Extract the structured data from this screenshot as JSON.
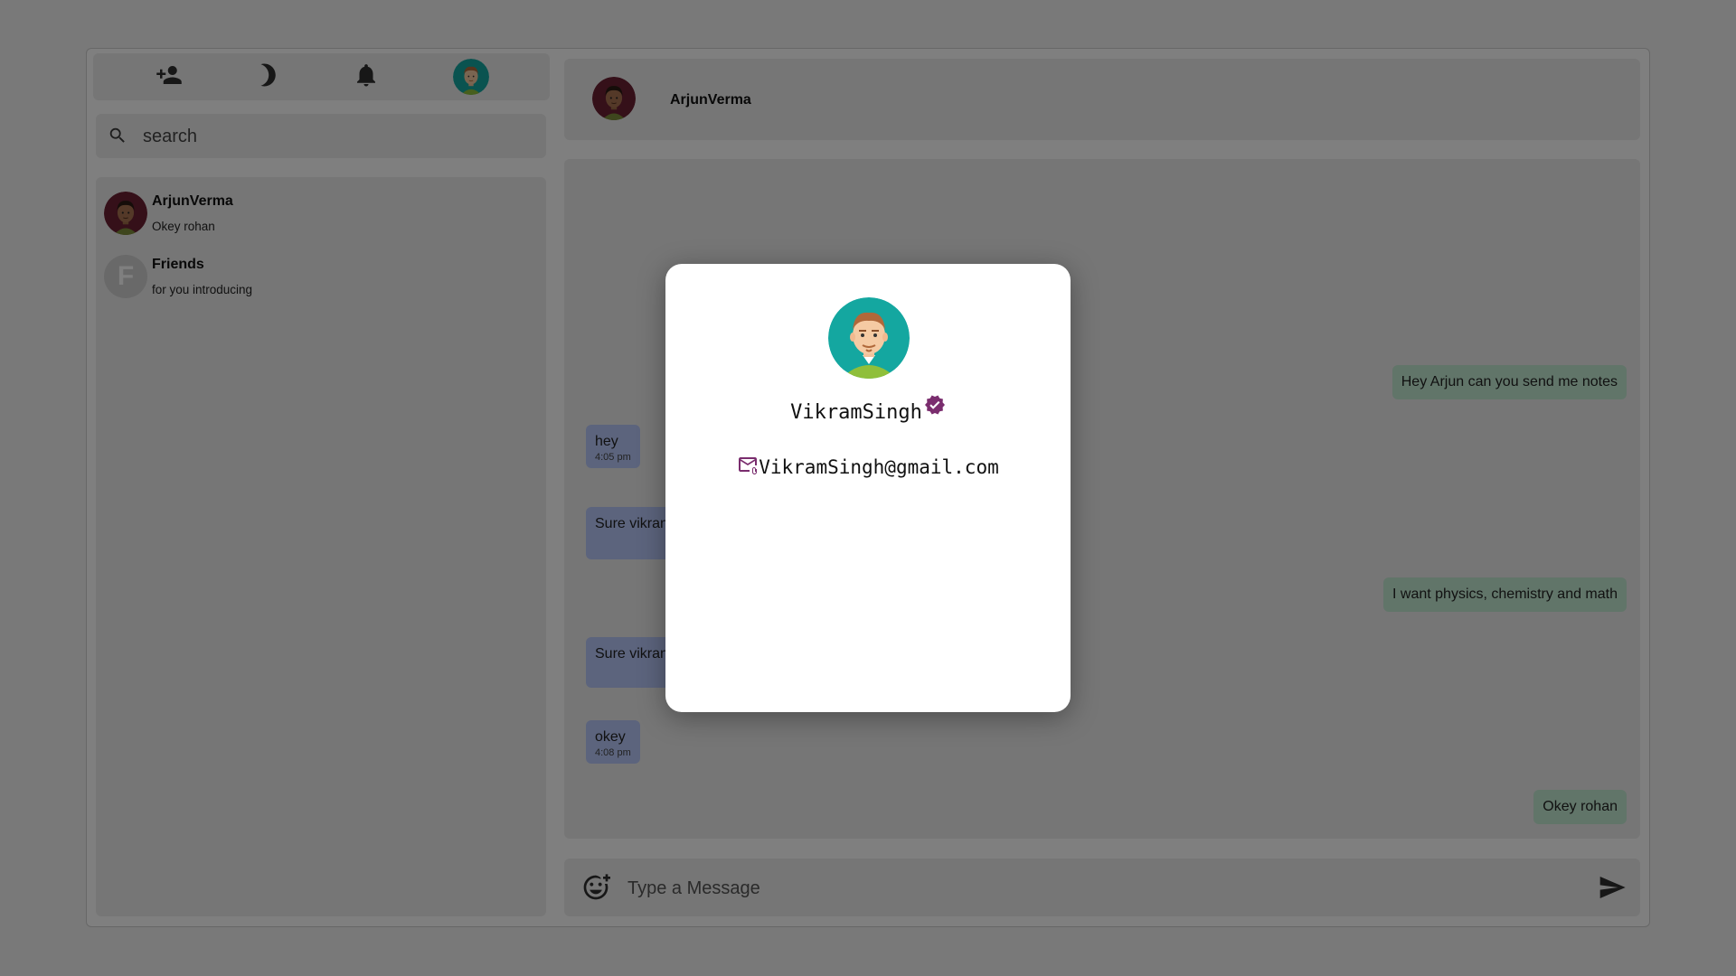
{
  "toolbar": {
    "icons": [
      "add-friend-icon",
      "dark-mode-icon",
      "notification-bell-icon",
      "profile-avatar"
    ]
  },
  "search": {
    "placeholder": "search"
  },
  "contacts": [
    {
      "name": "ArjunVerma",
      "last_message": "Okey rohan",
      "avatar": "avatar-arjun"
    },
    {
      "name": "Friends",
      "last_message": "for you introducing",
      "avatar_letter": "F"
    }
  ],
  "chat": {
    "header_name": "ArjunVerma",
    "messages": [
      {
        "direction": "out",
        "text": "Hey Arjun can you send me notes"
      },
      {
        "direction": "in",
        "text": "hey",
        "time": "4:05 pm"
      },
      {
        "direction": "in",
        "text": "Sure vikran"
      },
      {
        "direction": "out",
        "text": "I want physics, chemistry and math"
      },
      {
        "direction": "in",
        "text": "Sure vikran"
      },
      {
        "direction": "in",
        "text": "okey",
        "time": "4:08 pm"
      },
      {
        "direction": "out",
        "text": "Okey rohan"
      }
    ]
  },
  "composer": {
    "placeholder": "Type a Message"
  },
  "profile_modal": {
    "name": "VikramSingh",
    "email": "VikramSingh@gmail.com",
    "verified": true
  },
  "colors": {
    "incoming_bubble": "#b8c9fb",
    "outgoing_bubble": "#c3ead3",
    "accent_purple": "#7a2d6e",
    "overlay": "rgba(0,0,0,0.5)"
  }
}
